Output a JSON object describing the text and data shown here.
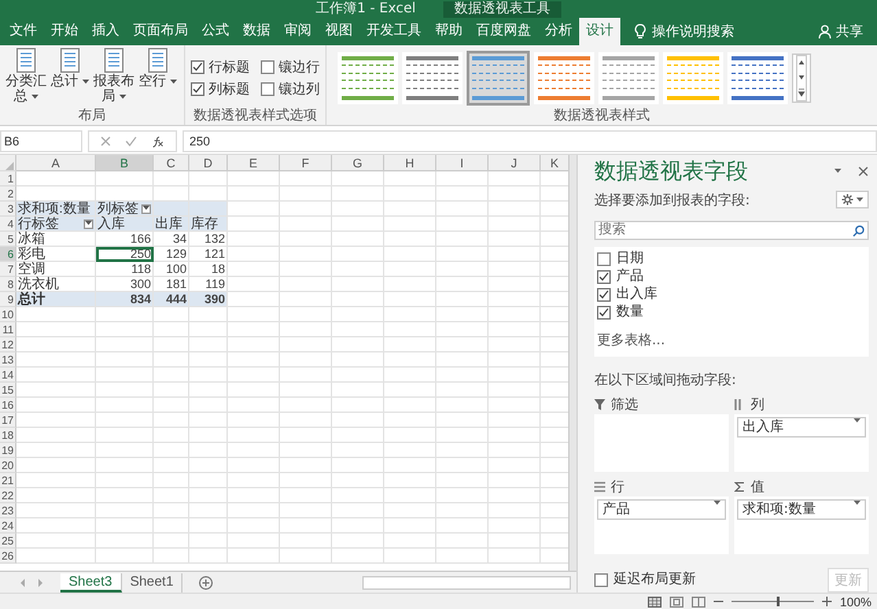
{
  "window": {
    "title": "工作簿1 - Excel",
    "context_title": "数据透视表工具"
  },
  "ribbon_tabs": [
    {
      "label": "文件",
      "selected": false
    },
    {
      "label": "开始",
      "selected": false
    },
    {
      "label": "插入",
      "selected": false
    },
    {
      "label": "页面布局",
      "selected": false
    },
    {
      "label": "公式",
      "selected": false
    },
    {
      "label": "数据",
      "selected": false
    },
    {
      "label": "审阅",
      "selected": false
    },
    {
      "label": "视图",
      "selected": false
    },
    {
      "label": "开发工具",
      "selected": false
    },
    {
      "label": "帮助",
      "selected": false
    },
    {
      "label": "百度网盘",
      "selected": false
    },
    {
      "label": "分析",
      "selected": false
    },
    {
      "label": "设计",
      "selected": true
    }
  ],
  "tell_me": "操作说明搜索",
  "share": "共享",
  "ribbon": {
    "layout_group": {
      "label": "布局",
      "buttons": [
        "分类汇总",
        "总计",
        "报表布局",
        "空行"
      ]
    },
    "options_group": {
      "label": "数据透视表样式选项",
      "options": [
        {
          "label": "行标题",
          "checked": true
        },
        {
          "label": "镶边行",
          "checked": false
        },
        {
          "label": "列标题",
          "checked": true
        },
        {
          "label": "镶边列",
          "checked": false
        }
      ]
    },
    "styles_group": {
      "label": "数据透视表样式",
      "styles": [
        {
          "color": "#70ad47",
          "selected": false
        },
        {
          "color": "#7f7f7f",
          "selected": false
        },
        {
          "color": "#5b9bd5",
          "selected": true
        },
        {
          "color": "#ed7d31",
          "selected": false
        },
        {
          "color": "#a5a5a5",
          "selected": false
        },
        {
          "color": "#ffc000",
          "selected": false
        },
        {
          "color": "#4472c4",
          "selected": false
        }
      ]
    }
  },
  "formula_bar": {
    "name_box": "B6",
    "value": "250"
  },
  "sheet": {
    "columns": [
      "A",
      "B",
      "C",
      "D",
      "E",
      "F",
      "G",
      "H",
      "I",
      "J",
      "K"
    ],
    "row_numbers": [
      "1",
      "2",
      "3",
      "4",
      "5",
      "6",
      "7",
      "8",
      "9",
      "10",
      "11",
      "12",
      "13",
      "14",
      "15",
      "16",
      "17",
      "18",
      "19",
      "20",
      "21",
      "22",
      "23",
      "24",
      "25",
      "26"
    ]
  },
  "pivot": {
    "rows": [
      {
        "kind": "title",
        "cells": [
          {
            "text": "求和项:数量"
          },
          {
            "text": "列标签",
            "filter": true
          }
        ]
      },
      {
        "kind": "header",
        "cells": [
          {
            "text": "行标签",
            "filter": true
          },
          {
            "text": "入库"
          },
          {
            "text": "出库"
          },
          {
            "text": "库存"
          }
        ]
      },
      {
        "kind": "item",
        "cells": [
          {
            "text": "冰箱",
            "selected": false
          },
          {
            "text": "166",
            "selected": false
          },
          {
            "text": "34",
            "selected": false
          },
          {
            "text": "132",
            "selected": false
          }
        ]
      },
      {
        "kind": "item",
        "cells": [
          {
            "text": "彩电",
            "selected": false
          },
          {
            "text": "250",
            "selected": true
          },
          {
            "text": "129",
            "selected": false
          },
          {
            "text": "121",
            "selected": false
          }
        ]
      },
      {
        "kind": "item",
        "cells": [
          {
            "text": "空调",
            "selected": false
          },
          {
            "text": "118",
            "selected": false
          },
          {
            "text": "100",
            "selected": false
          },
          {
            "text": "18",
            "selected": false
          }
        ]
      },
      {
        "kind": "item",
        "cells": [
          {
            "text": "洗衣机",
            "selected": false
          },
          {
            "text": "300",
            "selected": false
          },
          {
            "text": "181",
            "selected": false
          },
          {
            "text": "119",
            "selected": false
          }
        ]
      },
      {
        "kind": "total",
        "cells": [
          {
            "text": "总计"
          },
          {
            "text": "834"
          },
          {
            "text": "444"
          },
          {
            "text": "390"
          }
        ]
      }
    ]
  },
  "sheet_tabs": [
    {
      "label": "Sheet3",
      "selected": true
    },
    {
      "label": "Sheet1",
      "selected": false
    }
  ],
  "pane": {
    "title": "数据透视表字段",
    "subtitle": "选择要添加到报表的字段:",
    "search": {
      "placeholder": "搜索"
    },
    "fields": [
      {
        "label": "日期",
        "checked": false
      },
      {
        "label": "产品",
        "checked": true
      },
      {
        "label": "出入库",
        "checked": true
      },
      {
        "label": "数量",
        "checked": true
      }
    ],
    "more_tables": "更多表格...",
    "areas_hint": "在以下区域间拖动字段:",
    "areas": [
      {
        "kind": "filter",
        "label": "筛选"
      },
      {
        "kind": "columns",
        "label": "列",
        "items": [
          "出入库"
        ]
      },
      {
        "kind": "rows",
        "label": "行",
        "items": [
          "产品"
        ]
      },
      {
        "kind": "values",
        "label": "值",
        "items": [
          "求和项:数量"
        ]
      }
    ],
    "defer_update": {
      "label": "延迟布局更新",
      "checked": false
    },
    "update_button": {
      "label": "更新",
      "disabled": true
    }
  },
  "status_bar": {
    "zoom": "100%",
    "zoom_slider": {
      "level": 0.55
    }
  }
}
